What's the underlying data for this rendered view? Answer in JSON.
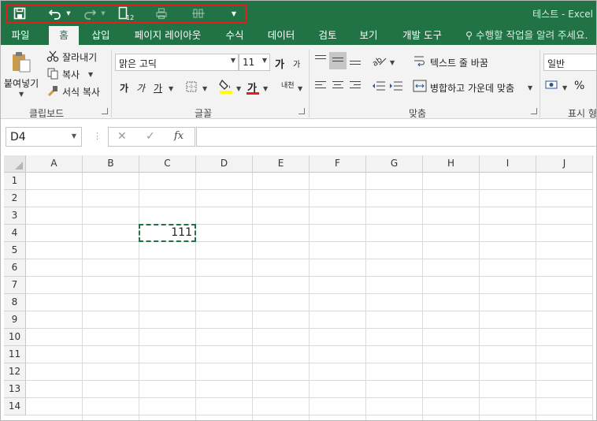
{
  "window": {
    "title": "테스트 - Excel"
  },
  "qat": {
    "save_icon": "save-icon",
    "undo_icon": "undo-icon",
    "redo_icon": "redo-icon",
    "page_layout_view_icon": "page-layout-view-icon",
    "page_layout_view_text": "12",
    "print_preview_icon": "print-icon",
    "form_icon": "form-icon",
    "customize_arrow": "▼"
  },
  "tabs": [
    {
      "label": "파일"
    },
    {
      "label": "홈"
    },
    {
      "label": "삽입"
    },
    {
      "label": "페이지 레이아웃"
    },
    {
      "label": "수식"
    },
    {
      "label": "데이터"
    },
    {
      "label": "검토"
    },
    {
      "label": "보기"
    },
    {
      "label": "개발 도구"
    }
  ],
  "tell_me": "수행할 작업을 알려 주세요.",
  "clipboard": {
    "paste_label": "붙여넣기",
    "cut_label": "잘라내기",
    "copy_label": "복사",
    "format_painter_label": "서식 복사",
    "group_label": "클립보드"
  },
  "font": {
    "name": "맑은 고딕",
    "size": "11",
    "grow_label": "가",
    "shrink_label": "가",
    "bold": "가",
    "italic": "가",
    "underline": "가",
    "font_color_glyph": "가",
    "phonetic_glyph": "내천",
    "group_label": "글꼴"
  },
  "alignment": {
    "wrap_text_label": "텍스트 줄 바꿈",
    "merge_center_label": "병합하고 가운데 맞춤",
    "group_label": "맞춤"
  },
  "number": {
    "format": "일반",
    "percent_label": "%",
    "group_label": "표시 형식"
  },
  "formula_bar": {
    "name_box": "D4",
    "cancel_glyph": "✕",
    "enter_glyph": "✓",
    "fx_label": "fx",
    "formula": ""
  },
  "sheet": {
    "columns": [
      "A",
      "B",
      "C",
      "D",
      "E",
      "F",
      "G",
      "H",
      "I",
      "J"
    ],
    "rows": [
      "1",
      "2",
      "3",
      "4",
      "5",
      "6",
      "7",
      "8",
      "9",
      "10",
      "11",
      "12",
      "13",
      "14"
    ],
    "cells": {
      "C4": "111"
    },
    "selected_cell": "C4"
  },
  "colors": {
    "accent": "#217346",
    "selection_border": "#217346",
    "highlight_box": "#e81b1b",
    "fill_color": "#ffff00",
    "font_color": "#e81b1b"
  }
}
